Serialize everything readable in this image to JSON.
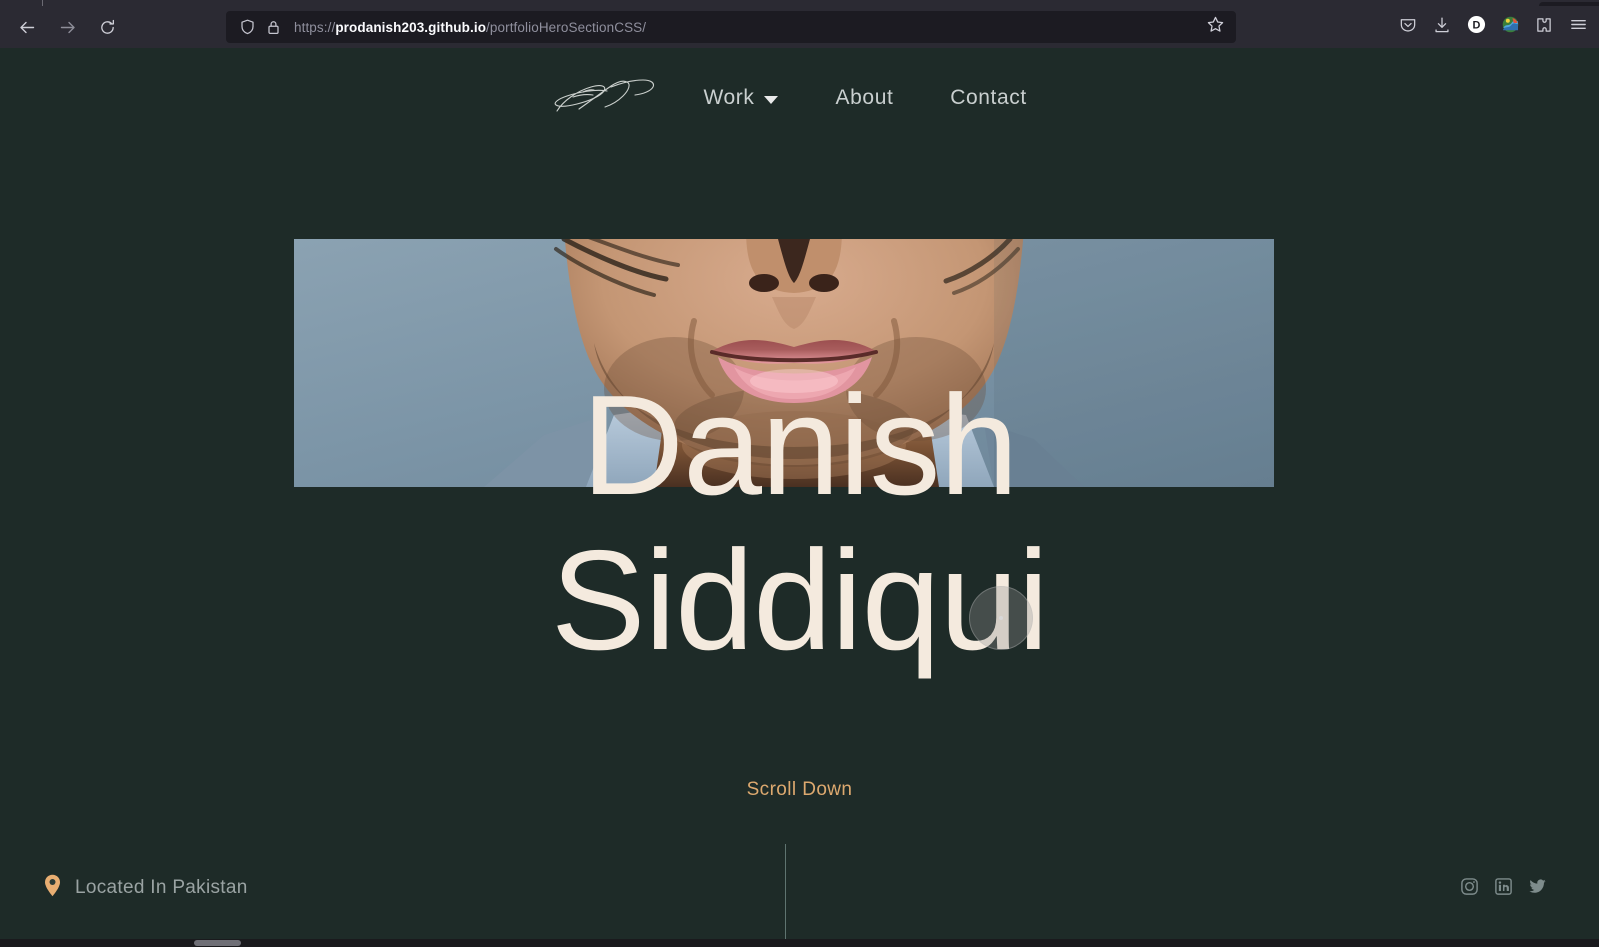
{
  "browser": {
    "back_icon": "back-arrow-icon",
    "forward_icon": "forward-arrow-icon",
    "reload_icon": "reload-icon",
    "shield_icon": "shield-icon",
    "lock_icon": "padlock-icon",
    "url_scheme": "https://",
    "url_host": "prodanish203.github.io",
    "url_path": "/portfolioHeroSectionCSS/",
    "url_full": "https://prodanish203.github.io/portfolioHeroSectionCSS/",
    "bookmark_icon": "star-outline-icon",
    "toolbar_icons": [
      {
        "name": "pocket-icon"
      },
      {
        "name": "downloads-icon"
      },
      {
        "name": "account-d-avatar-icon"
      },
      {
        "name": "extension-colorful-icon"
      },
      {
        "name": "extensions-puzzle-icon"
      },
      {
        "name": "app-menu-hamburger-icon"
      }
    ]
  },
  "site": {
    "logo_alt": "signature-logo",
    "nav": [
      {
        "label": "Work",
        "has_dropdown": true
      },
      {
        "label": "About",
        "has_dropdown": false
      },
      {
        "label": "Contact",
        "has_dropdown": false
      }
    ],
    "hero": {
      "line1": "Danish",
      "line2": "Siddiqui",
      "image_alt": "portrait-closeup-lower-face"
    },
    "scroll_down_label": "Scroll Down",
    "footer": {
      "location_icon": "map-pin-icon",
      "location_label": "Located In Pakistan",
      "social": [
        {
          "name": "instagram-icon"
        },
        {
          "name": "linkedin-icon"
        },
        {
          "name": "twitter-icon"
        }
      ]
    }
  },
  "colors": {
    "page_bg": "#1e2b28",
    "chrome_bg": "#2b2a33",
    "urlbar_bg": "#1c1b22",
    "hero_text": "#f4eade",
    "accent_orange": "#dda96f",
    "nav_text": "#c9cfcf",
    "muted_text": "#9aa3a3"
  }
}
